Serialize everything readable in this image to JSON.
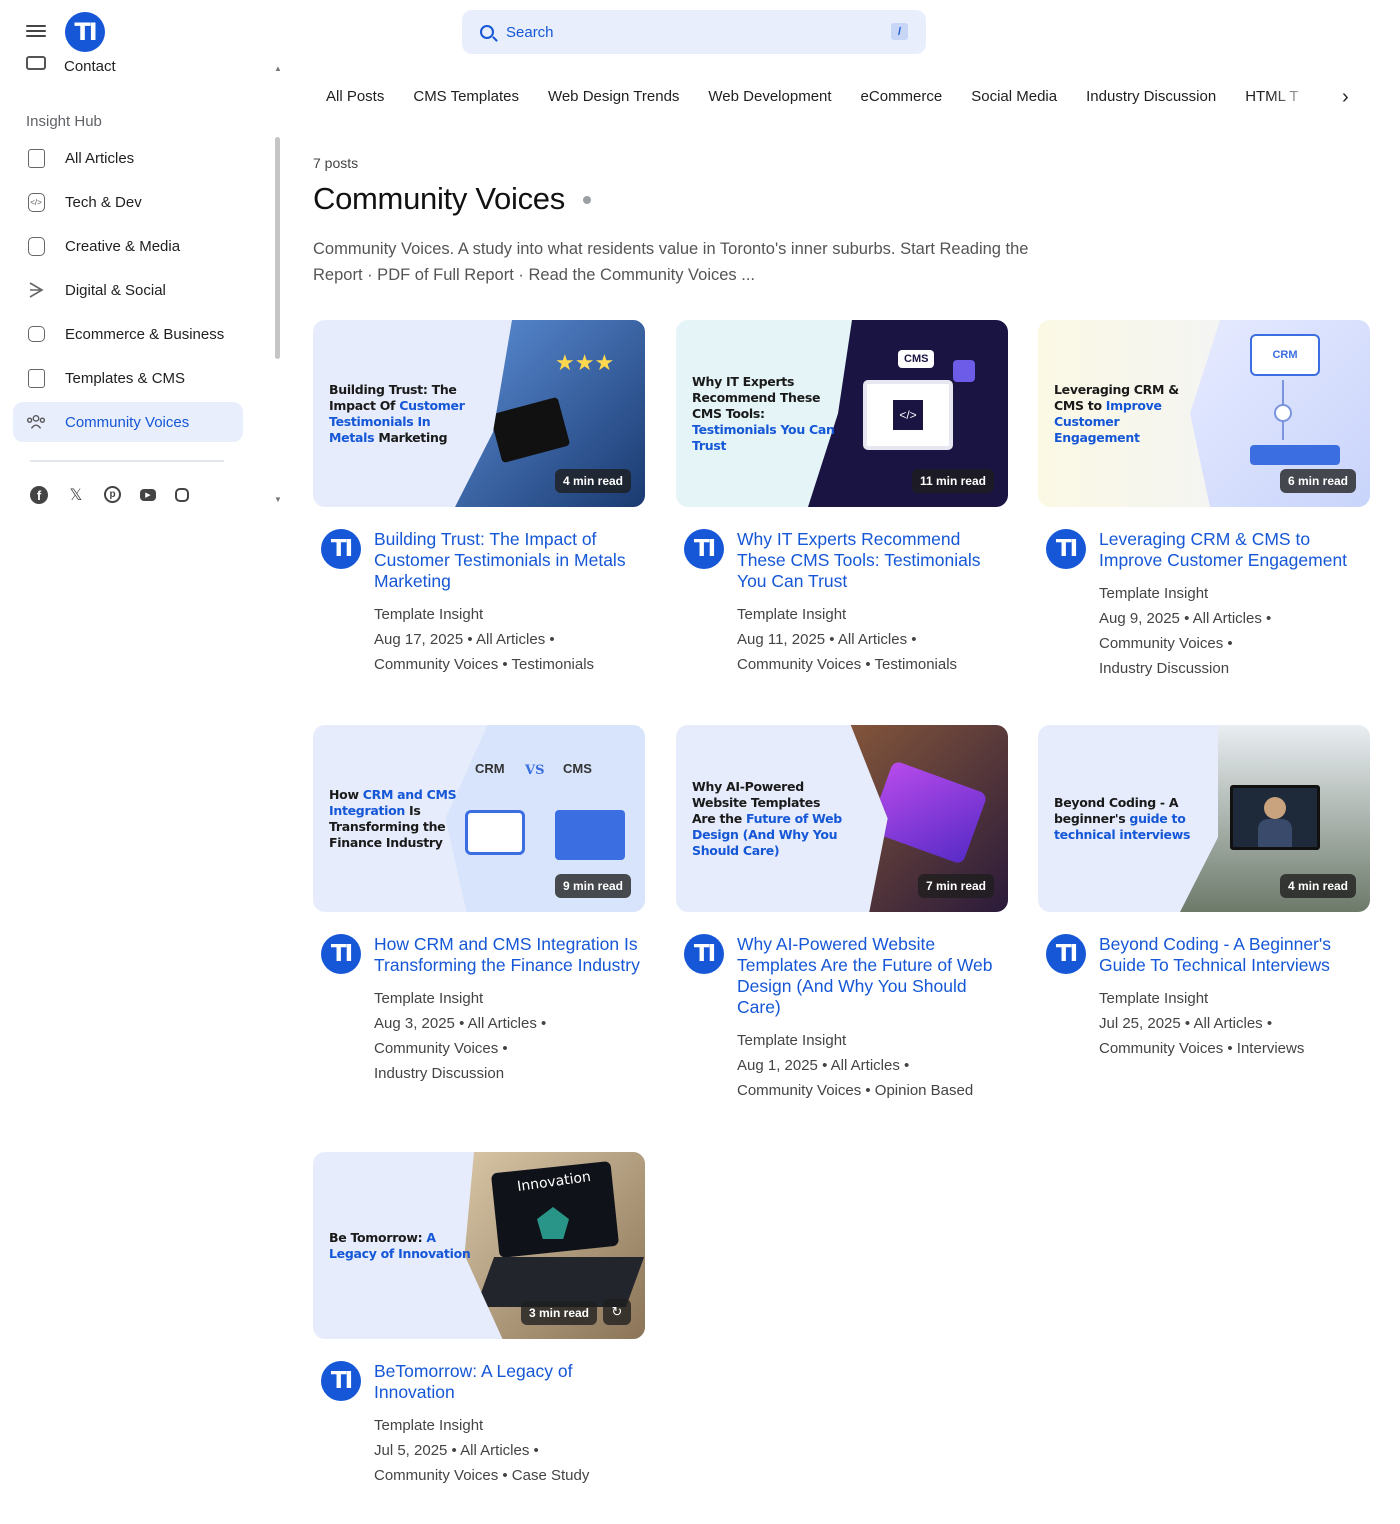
{
  "brand": {
    "logo_text": "TI"
  },
  "sidebar": {
    "contact_label": "Contact",
    "section_title": "Insight Hub",
    "items": [
      {
        "label": "All Articles",
        "icon": "articles-icon"
      },
      {
        "label": "Tech & Dev",
        "icon": "code-icon"
      },
      {
        "label": "Creative & Media",
        "icon": "image-icon"
      },
      {
        "label": "Digital & Social",
        "icon": "share-icon"
      },
      {
        "label": "Ecommerce & Business",
        "icon": "bag-icon"
      },
      {
        "label": "Templates & CMS",
        "icon": "template-icon"
      },
      {
        "label": "Community Voices",
        "icon": "people-icon",
        "active": true
      }
    ],
    "socials": [
      "facebook-icon",
      "x-icon",
      "pinterest-icon",
      "youtube-icon",
      "instagram-icon"
    ]
  },
  "search": {
    "label": "Search",
    "shortcut": "/"
  },
  "tabs": [
    "All Posts",
    "CMS Templates",
    "Web Design Trends",
    "Web Development",
    "eCommerce",
    "Social Media",
    "Industry Discussion",
    "HTML T"
  ],
  "page": {
    "posts_count": "7 posts",
    "title": "Community Voices",
    "description": "Community Voices. A study into what residents value in Toronto's inner suburbs. Start Reading the Report · PDF of Full Report · Read the Community Voices ..."
  },
  "colors": {
    "accent": "#1557d6",
    "active_bg": "#e8eefc"
  },
  "cards": [
    {
      "thumb_pre": "Building Trust: The Impact Of ",
      "thumb_hl": "Customer Testimonials In Metals",
      "thumb_post": " Marketing",
      "read": "4 min read",
      "title": "Building Trust: The Impact of Customer Testimonials in Metals Marketing",
      "author": "Template Insight",
      "meta": [
        "Aug 17, 2025  •  All Articles  •",
        "Community Voices  •  Testimonials"
      ]
    },
    {
      "thumb_pre": "Why IT Experts Recommend These CMS Tools: ",
      "thumb_hl": "Testimonials You Can Trust",
      "thumb_post": "",
      "read": "11 min read",
      "title": "Why IT Experts Recommend These CMS Tools: Testimonials You Can Trust",
      "author": "Template Insight",
      "meta": [
        "Aug 11, 2025  •  All Articles  •",
        "Community Voices  •  Testimonials"
      ]
    },
    {
      "thumb_pre": "Leveraging CRM & CMS to ",
      "thumb_hl": "Improve Customer Engagement",
      "thumb_post": "",
      "read": "6 min read",
      "title": "Leveraging CRM & CMS to Improve Customer Engagement",
      "author": "Template Insight",
      "meta": [
        "Aug 9, 2025  •  All Articles  •",
        "Community Voices  •",
        "Industry Discussion"
      ]
    },
    {
      "thumb_pre": "How ",
      "thumb_hl": "CRM and CMS Integration",
      "thumb_post": " Is Transforming the Finance Industry",
      "read": "9 min read",
      "art_labels": [
        "CRM",
        "VS",
        "CMS"
      ],
      "title": "How CRM and CMS Integration Is Transforming the Finance Industry",
      "author": "Template Insight",
      "meta": [
        "Aug 3, 2025  •  All Articles  •",
        "Community Voices  •",
        "Industry Discussion"
      ]
    },
    {
      "thumb_pre": "Why AI-Powered Website Templates Are the ",
      "thumb_hl": "Future of Web Design (And Why You Should Care)",
      "thumb_post": "",
      "read": "7 min read",
      "title": "Why AI-Powered Website Templates Are the Future of Web Design (And Why You Should Care)",
      "author": "Template Insight",
      "meta": [
        "Aug 1, 2025  •  All Articles  •",
        "Community Voices  •  Opinion Based"
      ]
    },
    {
      "thumb_pre": "Beyond Coding - A beginner's ",
      "thumb_hl": "guide to technical interviews",
      "thumb_post": "",
      "read": "4 min read",
      "title": "Beyond Coding - A Beginner's Guide To Technical Interviews",
      "author": "Template Insight",
      "meta": [
        "Jul 25, 2025  •  All Articles  •",
        "Community Voices  •  Interviews"
      ]
    },
    {
      "thumb_pre": "Be Tomorrow: ",
      "thumb_hl": "A Legacy of Innovation",
      "thumb_post": "",
      "read": "3 min read",
      "art_label": "Innovation",
      "title": "BeTomorrow: A Legacy of Innovation",
      "author": "Template Insight",
      "meta": [
        "Jul 5, 2025  •  All Articles  •",
        "Community Voices  •  Case Study"
      ]
    }
  ]
}
